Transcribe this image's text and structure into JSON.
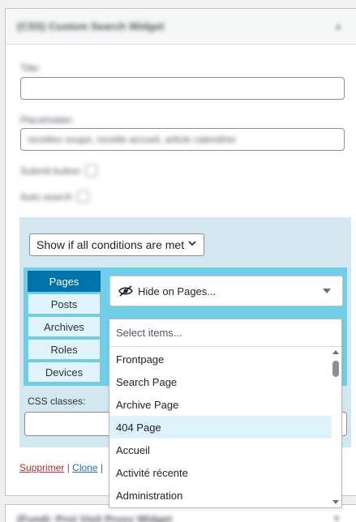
{
  "widget": {
    "title": "(CSS) Custom Search Widget",
    "collapse_icon": "triangle-up-icon"
  },
  "form": {
    "title_label": "Title:",
    "title_value": "",
    "placeholder_label": "Placeholder:",
    "placeholder_value": "recettes soupe, recette accueil, article calendrier",
    "submit_button_label": "Submit button",
    "auto_search_label": "Auto search"
  },
  "logic": {
    "condition_select": "Show if all conditions are met",
    "tabs": [
      {
        "label": "Pages",
        "active": true
      },
      {
        "label": "Posts",
        "active": false
      },
      {
        "label": "Archives",
        "active": false
      },
      {
        "label": "Roles",
        "active": false
      },
      {
        "label": "Devices",
        "active": false
      }
    ],
    "hide_select": {
      "label": "Hide on Pages...",
      "icon": "eye-slash-icon"
    },
    "css_classes_label": "CSS classes:",
    "css_classes_value": ""
  },
  "dropdown": {
    "search_placeholder": "Select items...",
    "items": [
      "Frontpage",
      "Search Page",
      "Archive Page",
      "404 Page",
      "Accueil",
      "Activité récente",
      "Administration"
    ],
    "highlighted_index": 3
  },
  "actions": {
    "delete_label": "Supprimer",
    "separator": "|",
    "clone_label": "Clone"
  },
  "next_widget": {
    "title": "(Fundi: Pro) Visit Proxy Widget"
  },
  "colors": {
    "accent_tab": "#0073aa",
    "tabs_bg": "#72cde6",
    "logic_bg": "#d3e8f1",
    "highlight_row": "#ddf2fa",
    "delete_link": "#b32d2e",
    "clone_link": "#2271b1"
  }
}
